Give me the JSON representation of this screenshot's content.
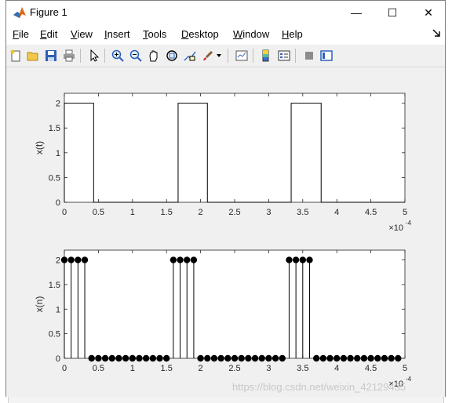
{
  "window": {
    "title": "Figure 1",
    "minimize_glyph": "—",
    "maximize_glyph": "☐",
    "close_glyph": "✕"
  },
  "menus": [
    {
      "label": "File",
      "underline": "F",
      "rest": "ile"
    },
    {
      "label": "Edit",
      "underline": "E",
      "rest": "dit"
    },
    {
      "label": "View",
      "underline": "V",
      "rest": "iew"
    },
    {
      "label": "Insert",
      "underline": "I",
      "rest": "nsert"
    },
    {
      "label": "Tools",
      "underline": "T",
      "rest": "ools"
    },
    {
      "label": "Desktop",
      "underline": "D",
      "rest": "esktop"
    },
    {
      "label": "Window",
      "underline": "W",
      "rest": "indow"
    },
    {
      "label": "Help",
      "underline": "H",
      "rest": "elp"
    }
  ],
  "toolbar_icons": [
    "new-figure-icon",
    "open-file-icon",
    "save-icon",
    "print-icon",
    "pointer-icon",
    "zoom-in-icon",
    "zoom-out-icon",
    "pan-icon",
    "rotate-3d-icon",
    "data-cursor-icon",
    "brush-icon",
    "brush-dropdown-icon",
    "link-plot-icon",
    "colorbar-icon",
    "legend-icon",
    "hide-plot-tools-icon",
    "show-plot-tools-icon"
  ],
  "colors": {
    "axes_bg": "#ffffff",
    "line": "#000000",
    "figure_bg": "#f0f0f0"
  },
  "chart_data": [
    {
      "type": "line",
      "ylabel": "x(t)",
      "xlabel": "",
      "x_multiplier": "×10",
      "x_exponent": "-4",
      "xlim": [
        0,
        5
      ],
      "ylim": [
        0,
        2.2
      ],
      "xticks": [
        "0",
        "0.5",
        "1",
        "1.5",
        "2",
        "2.5",
        "3",
        "3.5",
        "4",
        "4.5",
        "5"
      ],
      "yticks": [
        "0",
        "0.5",
        "1",
        "1.5",
        "2"
      ],
      "series": [
        {
          "x": [
            0,
            0,
            0.43,
            0.43,
            1.67,
            1.67,
            2.1,
            2.1,
            3.33,
            3.33,
            3.77,
            3.77,
            5
          ],
          "y": [
            0,
            2,
            2,
            0,
            0,
            2,
            2,
            0,
            0,
            2,
            2,
            0,
            0
          ]
        }
      ]
    },
    {
      "type": "scatter",
      "style": "stem",
      "ylabel": "x(n)",
      "xlabel": "",
      "x_multiplier": "×10",
      "x_exponent": "-4",
      "xlim": [
        0,
        5
      ],
      "ylim": [
        0,
        2.2
      ],
      "xticks": [
        "0",
        "0.5",
        "1",
        "1.5",
        "2",
        "2.5",
        "3",
        "3.5",
        "4",
        "4.5",
        "5"
      ],
      "yticks": [
        "0",
        "0.5",
        "1",
        "1.5",
        "2"
      ],
      "series": [
        {
          "x": [
            0,
            0.1,
            0.2,
            0.3,
            0.4,
            0.5,
            0.6,
            0.7,
            0.8,
            0.9,
            1.0,
            1.1,
            1.2,
            1.3,
            1.4,
            1.5,
            1.6,
            1.7,
            1.8,
            1.9,
            2.0,
            2.1,
            2.2,
            2.3,
            2.4,
            2.5,
            2.6,
            2.7,
            2.8,
            2.9,
            3.0,
            3.1,
            3.2,
            3.3,
            3.4,
            3.5,
            3.6,
            3.7,
            3.8,
            3.9,
            4.0,
            4.1,
            4.2,
            4.3,
            4.4,
            4.5,
            4.6,
            4.7,
            4.8,
            4.9
          ],
          "y": [
            2,
            2,
            2,
            2,
            0,
            0,
            0,
            0,
            0,
            0,
            0,
            0,
            0,
            0,
            0,
            0,
            2,
            2,
            2,
            2,
            0,
            0,
            0,
            0,
            0,
            0,
            0,
            0,
            0,
            0,
            0,
            0,
            0,
            2,
            2,
            2,
            2,
            0,
            0,
            0,
            0,
            0,
            0,
            0,
            0,
            0,
            0,
            0,
            0,
            0
          ]
        }
      ]
    }
  ],
  "watermark": "https://blog.csdn.net/weixin_42129435"
}
